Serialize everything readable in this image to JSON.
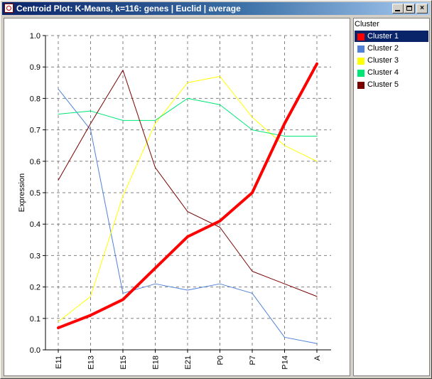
{
  "window": {
    "title": "Centroid Plot: K-Means, k=116: genes  | Euclid | average",
    "buttons": {
      "minimize": "_",
      "maximize": "□",
      "close": "×"
    }
  },
  "legend": {
    "header": "Cluster",
    "items": [
      {
        "label": "Cluster 1",
        "color": "#ff0000",
        "selected": true
      },
      {
        "label": "Cluster 2",
        "color": "#4f81d9",
        "selected": false
      },
      {
        "label": "Cluster 3",
        "color": "#ffff00",
        "selected": false
      },
      {
        "label": "Cluster 4",
        "color": "#00e676",
        "selected": false
      },
      {
        "label": "Cluster 5",
        "color": "#7a0000",
        "selected": false
      }
    ]
  },
  "chart_data": {
    "type": "line",
    "x": [
      "E11",
      "E13",
      "E15",
      "E18",
      "E21",
      "P0",
      "P7",
      "P14",
      "A"
    ],
    "ylabel": "Expression",
    "xlabel": "",
    "ylim": [
      0.0,
      1.0
    ],
    "yticks": [
      "0.0",
      "0.1",
      "0.2",
      "0.3",
      "0.4",
      "0.5",
      "0.6",
      "0.7",
      "0.8",
      "0.9",
      "1.0"
    ],
    "grid": true,
    "series": [
      {
        "name": "Cluster 1",
        "color": "#ff0000",
        "width": 4,
        "values": [
          0.07,
          0.11,
          0.16,
          0.26,
          0.36,
          0.41,
          0.5,
          0.72,
          0.91
        ]
      },
      {
        "name": "Cluster 2",
        "color": "#4f81d9",
        "width": 1,
        "values": [
          0.83,
          0.7,
          0.18,
          0.21,
          0.19,
          0.21,
          0.18,
          0.04,
          0.02
        ]
      },
      {
        "name": "Cluster 3",
        "color": "#ffff00",
        "width": 1,
        "values": [
          0.09,
          0.17,
          0.49,
          0.72,
          0.85,
          0.87,
          0.74,
          0.65,
          0.6
        ]
      },
      {
        "name": "Cluster 4",
        "color": "#00e676",
        "width": 1,
        "values": [
          0.75,
          0.76,
          0.73,
          0.73,
          0.8,
          0.78,
          0.7,
          0.68,
          0.68
        ]
      },
      {
        "name": "Cluster 5",
        "color": "#7a0000",
        "width": 1,
        "values": [
          0.54,
          0.72,
          0.89,
          0.58,
          0.44,
          0.39,
          0.25,
          0.21,
          0.17
        ]
      }
    ]
  }
}
